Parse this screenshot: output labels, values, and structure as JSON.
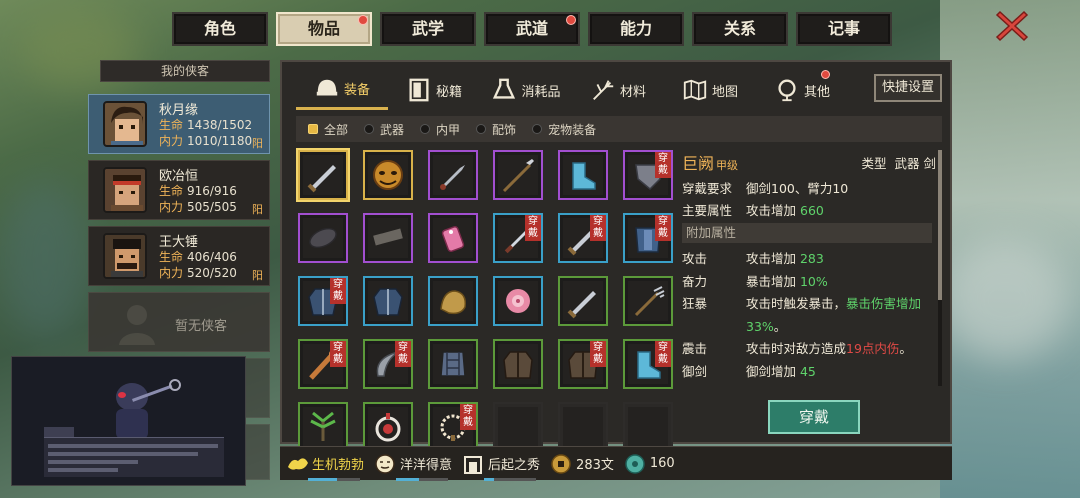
{
  "top_tabs": [
    {
      "label": "角色",
      "active": false,
      "badge": false
    },
    {
      "label": "物品",
      "active": true,
      "badge": true
    },
    {
      "label": "武学",
      "active": false,
      "badge": false
    },
    {
      "label": "武道",
      "active": false,
      "badge": true
    },
    {
      "label": "能力",
      "active": false,
      "badge": false
    },
    {
      "label": "关系",
      "active": false,
      "badge": false
    },
    {
      "label": "记事",
      "active": false,
      "badge": false
    }
  ],
  "close_icon": "close-x-icon",
  "party": {
    "header": "我的侠客",
    "members": [
      {
        "name": "秋月缘",
        "hp_label": "生命",
        "hp": "1438/1502",
        "mp_label": "内力",
        "mp": "1010/1180",
        "tag": "阳",
        "active": true
      },
      {
        "name": "欧冶恒",
        "hp_label": "生命",
        "hp": "916/916",
        "mp_label": "内力",
        "mp": "505/505",
        "tag": "阳",
        "active": false
      },
      {
        "name": "王大锤",
        "hp_label": "生命",
        "hp": "406/406",
        "mp_label": "内力",
        "mp": "520/520",
        "tag": "阳",
        "active": false
      }
    ],
    "empty_label": "暂无侠客"
  },
  "sub_tabs": [
    {
      "label": "装备",
      "icon": "helmet-icon",
      "active": true,
      "badge": false
    },
    {
      "label": "秘籍",
      "icon": "book-icon",
      "active": false,
      "badge": false
    },
    {
      "label": "消耗品",
      "icon": "potion-icon",
      "active": false,
      "badge": false
    },
    {
      "label": "材料",
      "icon": "herb-icon",
      "active": false,
      "badge": false
    },
    {
      "label": "地图",
      "icon": "map-icon",
      "active": false,
      "badge": false
    },
    {
      "label": "其他",
      "icon": "lamp-icon",
      "active": false,
      "badge": true
    }
  ],
  "quick_settings": "快捷设置",
  "filters": [
    {
      "label": "全部",
      "active": true
    },
    {
      "label": "武器",
      "active": false
    },
    {
      "label": "内甲",
      "active": false
    },
    {
      "label": "配饰",
      "active": false
    },
    {
      "label": "宠物装备",
      "active": false
    }
  ],
  "worn_label": "穿戴",
  "items": [
    {
      "icon": "sword-icon",
      "rarity": "gold",
      "worn": false,
      "selected": true
    },
    {
      "icon": "mask-icon",
      "rarity": "gold",
      "worn": false
    },
    {
      "icon": "knife-icon",
      "rarity": "purple",
      "worn": false
    },
    {
      "icon": "spear-icon",
      "rarity": "purple",
      "worn": false
    },
    {
      "icon": "boots-icon",
      "rarity": "purple",
      "worn": false
    },
    {
      "icon": "gauntlet-icon",
      "rarity": "purple",
      "worn": true
    },
    {
      "icon": "gem-icon",
      "rarity": "purple",
      "worn": false
    },
    {
      "icon": "bar-icon",
      "rarity": "purple",
      "worn": false
    },
    {
      "icon": "charm-icon",
      "rarity": "purple",
      "worn": false
    },
    {
      "icon": "dagger-icon",
      "rarity": "blue",
      "worn": true
    },
    {
      "icon": "sword-icon",
      "rarity": "blue",
      "worn": true
    },
    {
      "icon": "armor-icon",
      "rarity": "blue",
      "worn": true
    },
    {
      "icon": "robe-icon",
      "rarity": "blue",
      "worn": true
    },
    {
      "icon": "robe-icon",
      "rarity": "blue",
      "worn": false
    },
    {
      "icon": "stone-icon",
      "rarity": "blue",
      "worn": false
    },
    {
      "icon": "flower-icon",
      "rarity": "blue",
      "worn": false
    },
    {
      "icon": "sword-icon",
      "rarity": "green",
      "worn": false
    },
    {
      "icon": "trident-icon",
      "rarity": "green",
      "worn": false
    },
    {
      "icon": "club-icon",
      "rarity": "green",
      "worn": true
    },
    {
      "icon": "claw-icon",
      "rarity": "green",
      "worn": true
    },
    {
      "icon": "vest-icon",
      "rarity": "green",
      "worn": false
    },
    {
      "icon": "coat-icon",
      "rarity": "green",
      "worn": false
    },
    {
      "icon": "coat-icon",
      "rarity": "green",
      "worn": true
    },
    {
      "icon": "boots-icon",
      "rarity": "green",
      "worn": true
    },
    {
      "icon": "herb-icon",
      "rarity": "green",
      "worn": false
    },
    {
      "icon": "ring-icon",
      "rarity": "green",
      "worn": false
    },
    {
      "icon": "beads-icon",
      "rarity": "green",
      "worn": true
    },
    {
      "icon": "",
      "rarity": "empty",
      "worn": false
    },
    {
      "icon": "",
      "rarity": "empty",
      "worn": false
    },
    {
      "icon": "",
      "rarity": "empty",
      "worn": false
    }
  ],
  "detail": {
    "name": "巨阙",
    "grade": "甲级",
    "type_label": "类型",
    "type_value": "武器 剑",
    "req_label": "穿戴要求",
    "req_value": "御剑100、臂力10",
    "main_label": "主要属性",
    "main_prefix": "攻击增加",
    "main_value": "660",
    "extra_header": "附加属性",
    "attrs": [
      {
        "k": "攻击",
        "pre": "攻击增加 ",
        "hl": "283",
        "hl_color": "green",
        "post": ""
      },
      {
        "k": "奋力",
        "pre": "暴击增加 ",
        "hl": "10%",
        "hl_color": "green",
        "post": ""
      },
      {
        "k": "狂暴",
        "pre": "攻击时触发暴击，",
        "hl": "暴击伤害增加",
        "hl_color": "green",
        "post": ""
      },
      {
        "k": "",
        "pre": "",
        "hl": "33%",
        "hl_color": "green",
        "post": "。"
      },
      {
        "k": "震击",
        "pre": "攻击时对敌方造成",
        "hl": "19点内伤",
        "hl_color": "red",
        "post": "。"
      },
      {
        "k": "御剑",
        "pre": "御剑增加 ",
        "hl": "45",
        "hl_color": "green",
        "post": ""
      }
    ],
    "wear_button": "穿戴"
  },
  "status_bar": [
    {
      "icon": "muscle-icon",
      "label": "生机勃勃",
      "good": true,
      "fill": 0.55
    },
    {
      "icon": "face-icon",
      "label": "洋洋得意",
      "good": false,
      "fill": 0.45
    },
    {
      "icon": "gate-icon",
      "label": "后起之秀",
      "good": false,
      "fill": 0.2
    }
  ],
  "currency": [
    {
      "icon": "coin-icon",
      "value": "283文"
    },
    {
      "icon": "jade-icon",
      "value": "160"
    }
  ]
}
